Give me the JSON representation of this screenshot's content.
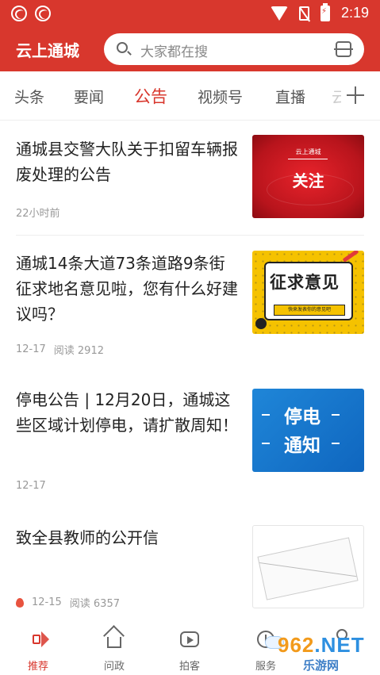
{
  "status_bar": {
    "time": "2:19"
  },
  "header": {
    "app_title": "云上通城",
    "search_placeholder": "大家都在搜"
  },
  "tabs": [
    {
      "label": "头条",
      "active": false
    },
    {
      "label": "要闻",
      "active": false
    },
    {
      "label": "公告",
      "active": true
    },
    {
      "label": "视频号",
      "active": false
    },
    {
      "label": "直播",
      "active": false
    }
  ],
  "feed": [
    {
      "title": "通城县交警大队关于扣留车辆报废处理的公告",
      "date": "22小时前",
      "reads": "",
      "thumb_caption": "云上通城",
      "thumb_text": "关注"
    },
    {
      "title": "通城14条大道73条道路9条街征求地名意见啦，您有什么好建议吗？",
      "date": "12-17",
      "reads": "阅读 2912",
      "thumb_text": "征求意见",
      "thumb_sub": "快来发表你的意见吧"
    },
    {
      "title": "停电公告 | 12月20日，通城这些区域计划停电，请扩散周知！",
      "date": "12-17",
      "reads": "",
      "thumb_line1": "停电",
      "thumb_line2": "通知"
    },
    {
      "title": "致全县教师的公开信",
      "date": "12-15",
      "reads": "阅读 6357"
    }
  ],
  "bottom_nav": [
    {
      "label": "推荐",
      "icon": "speaker-icon",
      "active": true
    },
    {
      "label": "问政",
      "icon": "house-icon",
      "active": false
    },
    {
      "label": "拍客",
      "icon": "camera-icon",
      "active": false
    },
    {
      "label": "服务",
      "icon": "clock-icon",
      "active": false
    },
    {
      "label": "",
      "icon": "user-icon",
      "active": false
    }
  ],
  "watermark": {
    "number_part1": "962",
    "number_part2": ".NET",
    "sub": "乐游网"
  },
  "colors": {
    "brand_red": "#d8372d",
    "text_dark": "#222222",
    "text_meta": "#999999"
  }
}
